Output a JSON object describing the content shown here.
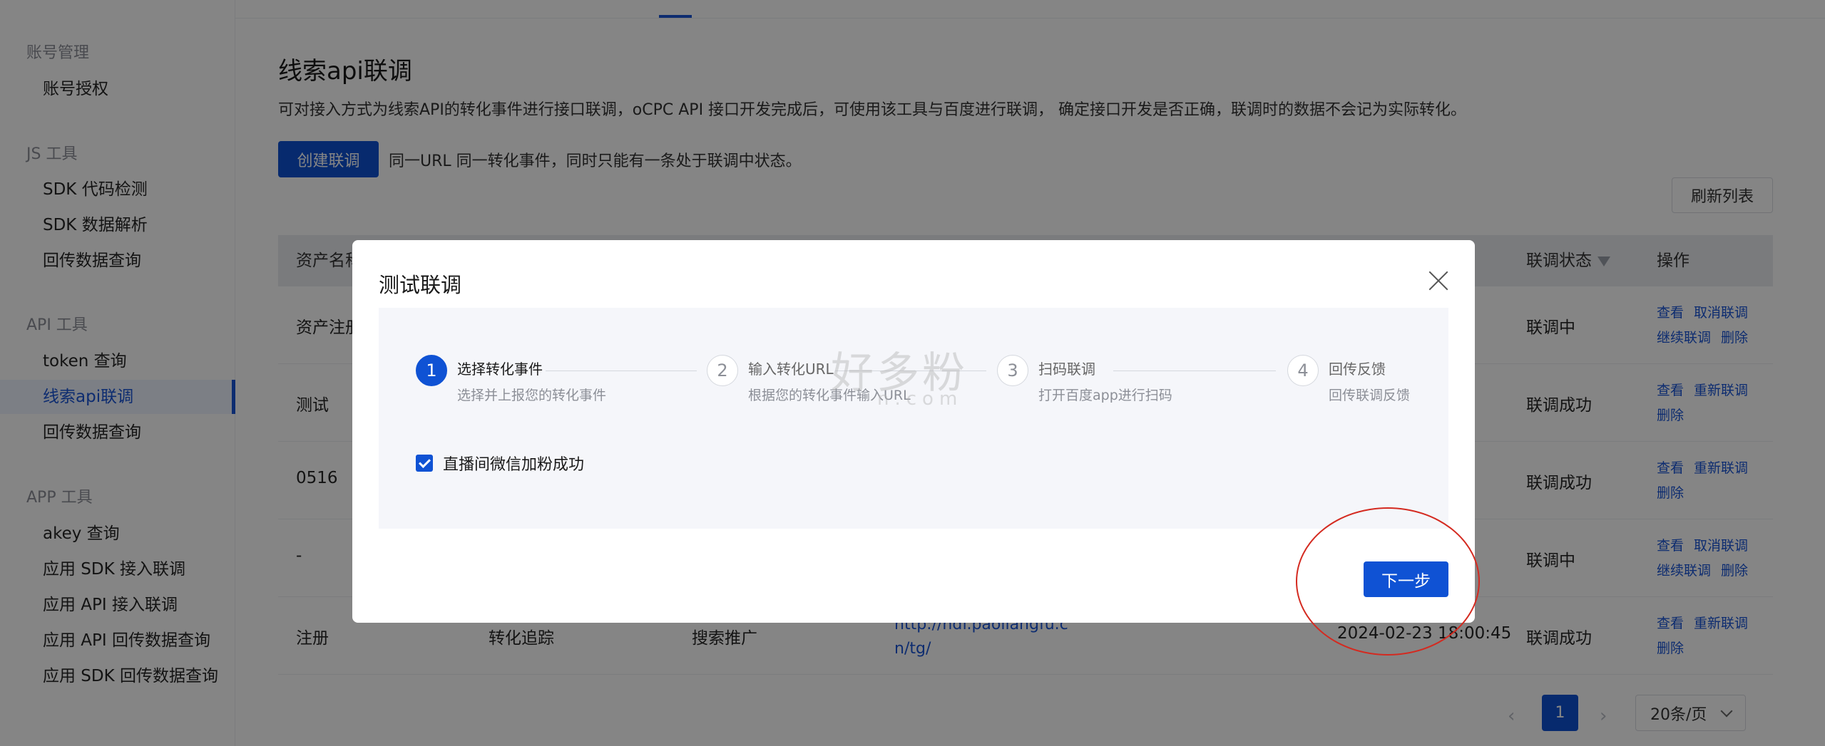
{
  "sidebar": {
    "groups": [
      {
        "title": "账号管理",
        "items": [
          "账号授权"
        ]
      },
      {
        "title": "JS 工具",
        "items": [
          "SDK 代码检测",
          "SDK 数据解析",
          "回传数据查询"
        ]
      },
      {
        "title": "API 工具",
        "items": [
          "token 查询",
          "线索api联调",
          "回传数据查询"
        ]
      },
      {
        "title": "APP 工具",
        "items": [
          "akey 查询",
          "应用 SDK 接入联调",
          "应用 API 接入联调",
          "应用 API 回传数据查询",
          "应用 SDK 回传数据查询"
        ]
      }
    ],
    "active_item": "线索api联调"
  },
  "page": {
    "title": "线索api联调",
    "description": "可对接入方式为线索API的转化事件进行接口联调，oCPC API 接口开发完成后，可使用该工具与百度进行联调， 确定接口开发是否正确，联调时的数据不会记为实际转化。",
    "create_button": "创建联调",
    "create_hint": "同一URL 同一转化事件，同时只能有一条处于联调中状态。",
    "refresh_button": "刷新列表"
  },
  "table": {
    "columns": {
      "asset_name": "资产名称",
      "status": "联调状态",
      "actions": "操作"
    },
    "rows": [
      {
        "asset_name": "资产注册",
        "status": "联调中",
        "actions": [
          "查看",
          "取消联调",
          "继续联调",
          "删除"
        ]
      },
      {
        "asset_name": "测试",
        "status": "联调成功",
        "actions": [
          "查看",
          "重新联调",
          "删除"
        ]
      },
      {
        "asset_name": "0516",
        "status": "联调成功",
        "actions": [
          "查看",
          "重新联调",
          "删除"
        ]
      },
      {
        "asset_name": "-",
        "status": "联调中",
        "actions": [
          "查看",
          "取消联调",
          "继续联调",
          "删除"
        ]
      },
      {
        "asset_name": "注册",
        "col2": "转化追踪",
        "col3": "搜索推广",
        "url": "http://hdf.paoliangfu.cn/tg/",
        "time": "2024-02-23 18:00:45",
        "status": "联调成功",
        "actions": [
          "查看",
          "重新联调",
          "删除"
        ]
      }
    ]
  },
  "pagination": {
    "current": "1",
    "page_size": "20条/页",
    "prev": "‹",
    "next": "›"
  },
  "modal": {
    "title": "测试联调",
    "steps": [
      {
        "num": "1",
        "title": "选择转化事件",
        "desc": "选择并上报您的转化事件",
        "active": true
      },
      {
        "num": "2",
        "title": "输入转化URL",
        "desc": "根据您的转化事件输入URL",
        "active": false
      },
      {
        "num": "3",
        "title": "扫码联调",
        "desc": "打开百度app进行扫码",
        "active": false
      },
      {
        "num": "4",
        "title": "回传反馈",
        "desc": "回传联调反馈",
        "active": false
      }
    ],
    "checkbox_label": "直播间微信加粉成功",
    "checkbox_checked": true,
    "next_button": "下一步"
  },
  "watermark": {
    "main": "好多粉",
    "sub": "n.com"
  },
  "colors": {
    "primary": "#0f52d4",
    "annotation": "#d42a20"
  }
}
